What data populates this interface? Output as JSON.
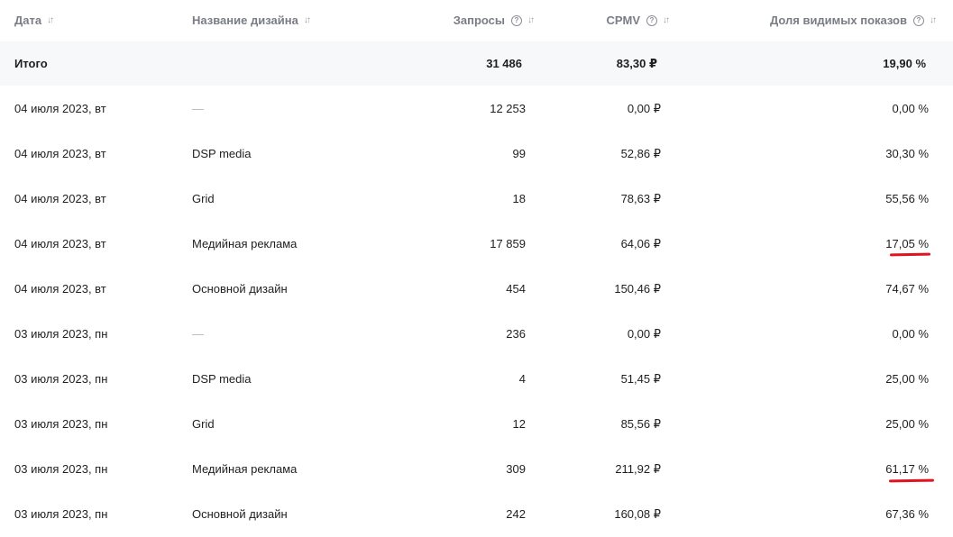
{
  "columns": {
    "date": "Дата",
    "name": "Название дизайна",
    "requests": "Запросы",
    "cpmv": "CPMV",
    "share": "Доля видимых показов"
  },
  "total": {
    "label": "Итого",
    "requests": "31 486",
    "cpmv": "83,30 ₽",
    "share": "19,90 %"
  },
  "rows": [
    {
      "date": "04 июля 2023, вт",
      "name": "—",
      "requests": "12 253",
      "cpmv": "0,00 ₽",
      "share": "0,00 %"
    },
    {
      "date": "04 июля 2023, вт",
      "name": "DSP media",
      "requests": "99",
      "cpmv": "52,86 ₽",
      "share": "30,30 %"
    },
    {
      "date": "04 июля 2023, вт",
      "name": "Grid",
      "requests": "18",
      "cpmv": "78,63 ₽",
      "share": "55,56 %"
    },
    {
      "date": "04 июля 2023, вт",
      "name": "Медийная реклама",
      "requests": "17 859",
      "cpmv": "64,06 ₽",
      "share": "17,05 %"
    },
    {
      "date": "04 июля 2023, вт",
      "name": "Основной дизайн",
      "requests": "454",
      "cpmv": "150,46 ₽",
      "share": "74,67 %"
    },
    {
      "date": "03 июля 2023, пн",
      "name": "—",
      "requests": "236",
      "cpmv": "0,00 ₽",
      "share": "0,00 %"
    },
    {
      "date": "03 июля 2023, пн",
      "name": "DSP media",
      "requests": "4",
      "cpmv": "51,45 ₽",
      "share": "25,00 %"
    },
    {
      "date": "03 июля 2023, пн",
      "name": "Grid",
      "requests": "12",
      "cpmv": "85,56 ₽",
      "share": "25,00 %"
    },
    {
      "date": "03 июля 2023, пн",
      "name": "Медийная реклама",
      "requests": "309",
      "cpmv": "211,92 ₽",
      "share": "61,17 %"
    },
    {
      "date": "03 июля 2023, пн",
      "name": "Основной дизайн",
      "requests": "242",
      "cpmv": "160,08 ₽",
      "share": "67,36 %"
    }
  ],
  "icons": {
    "sort": "sort-arrows-icon",
    "help": "help-circle-icon"
  },
  "colors": {
    "annotation": "#e0131f",
    "total_bg": "#f7f8fa",
    "header_text": "#7a7d85"
  }
}
